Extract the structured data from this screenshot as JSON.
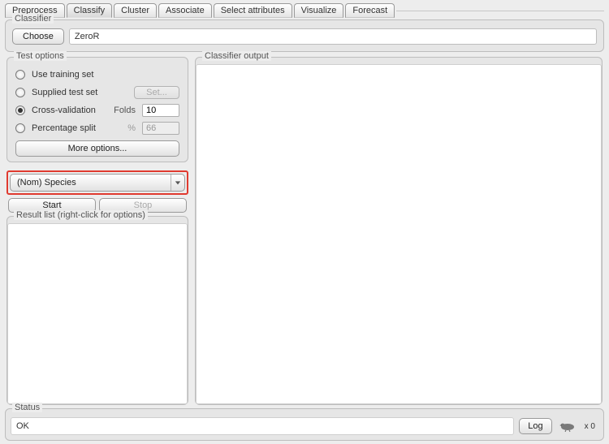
{
  "tabs": [
    {
      "label": "Preprocess"
    },
    {
      "label": "Classify"
    },
    {
      "label": "Cluster"
    },
    {
      "label": "Associate"
    },
    {
      "label": "Select attributes"
    },
    {
      "label": "Visualize"
    },
    {
      "label": "Forecast"
    }
  ],
  "active_tab_index": 1,
  "classifier": {
    "section_label": "Classifier",
    "choose_label": "Choose",
    "value": "ZeroR"
  },
  "test_options": {
    "section_label": "Test options",
    "use_training_label": "Use training set",
    "supplied_test_label": "Supplied test set",
    "set_btn_label": "Set...",
    "cross_validation_label": "Cross-validation",
    "folds_label": "Folds",
    "folds_value": "10",
    "percentage_split_label": "Percentage split",
    "percent_symbol": "%",
    "percent_value": "66",
    "more_options_label": "More options...",
    "selected_option": "cross_validation"
  },
  "class_attribute": {
    "value": "(Nom) Species"
  },
  "actions": {
    "start_label": "Start",
    "stop_label": "Stop"
  },
  "result_list": {
    "section_label": "Result list (right-click for options)"
  },
  "output": {
    "section_label": "Classifier output"
  },
  "status": {
    "section_label": "Status",
    "text": "OK",
    "log_label": "Log",
    "activity_count": "x 0"
  }
}
